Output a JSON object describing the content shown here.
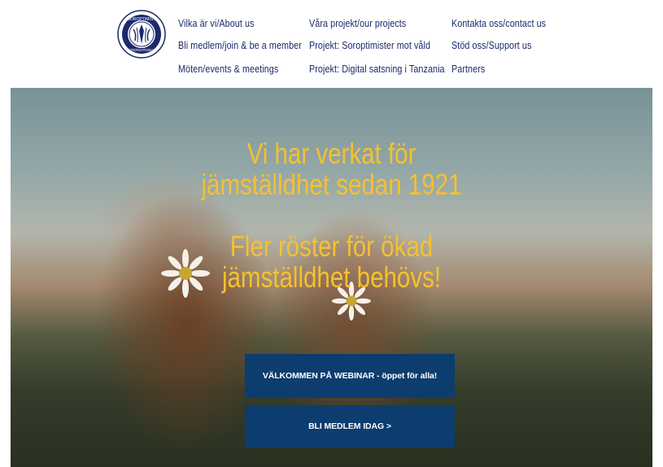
{
  "nav": {
    "col1": [
      "Vilka är vi/About us",
      "Bli medlem/join & be a member",
      "Möten/events & meetings"
    ],
    "col2": [
      "Våra projekt/our projects",
      "Projekt: Soroptimister mot våld",
      "Projekt: Digital satsning i Tanzania"
    ],
    "col3": [
      "Kontakta oss/contact us",
      "Stöd oss/Support us",
      "Partners"
    ]
  },
  "logo": {
    "top_text": "SOROPTIMIST",
    "bottom_text": "INTERNATIONAL"
  },
  "hero": {
    "headline1_line1": "Vi har verkat för",
    "headline1_line2": "jämställdhet sedan 1921",
    "headline2_line1": "Fler röster för ökad",
    "headline2_line2": "jämställdhet behövs!",
    "button_webinar": "VÄLKOMMEN PÅ WEBINAR - öppet för alla!",
    "button_member": "BLI MEDLEM IDAG >"
  },
  "colors": {
    "nav_text": "#1c2a6b",
    "headline": "#f5c12e",
    "button_bg": "#0d3c6e",
    "button_text": "#ffffff"
  }
}
